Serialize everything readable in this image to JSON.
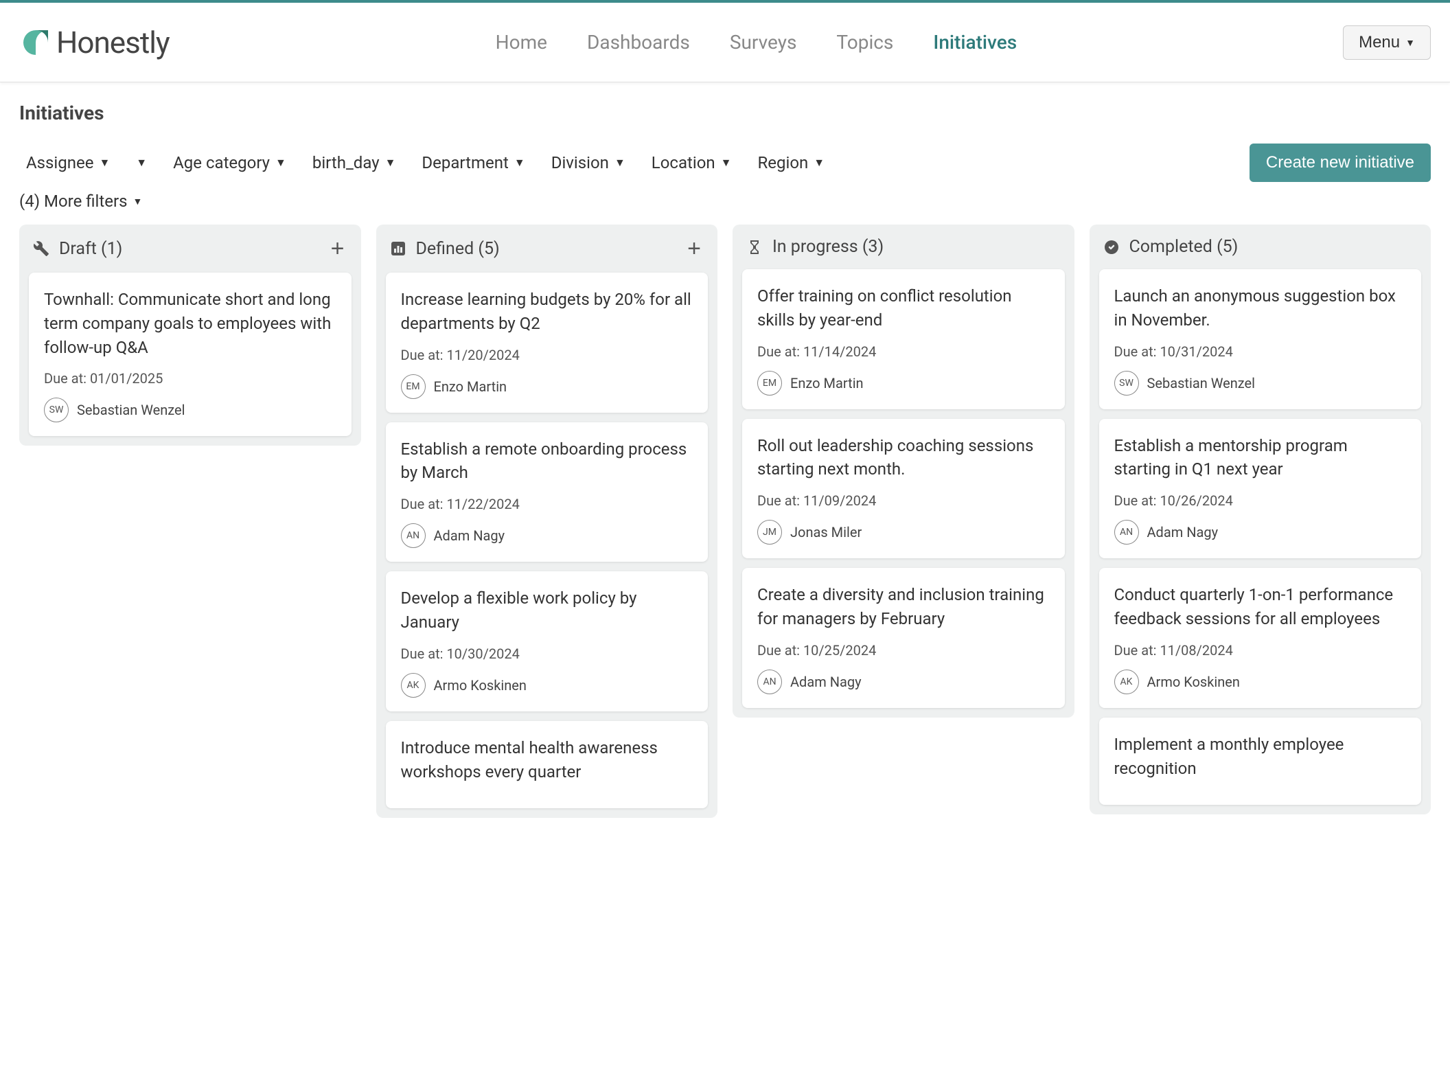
{
  "brand": "Honestly",
  "nav": {
    "items": [
      {
        "label": "Home",
        "active": false
      },
      {
        "label": "Dashboards",
        "active": false
      },
      {
        "label": "Surveys",
        "active": false
      },
      {
        "label": "Topics",
        "active": false
      },
      {
        "label": "Initiatives",
        "active": true
      }
    ],
    "menu_label": "Menu"
  },
  "page": {
    "title": "Initiatives"
  },
  "filters": {
    "items": [
      {
        "label": "Assignee"
      },
      {
        "label": ""
      },
      {
        "label": "Age category"
      },
      {
        "label": "birth_day"
      },
      {
        "label": "Department"
      },
      {
        "label": "Division"
      },
      {
        "label": "Location"
      },
      {
        "label": "Region"
      }
    ],
    "more_label": "(4) More filters",
    "create_label": "Create new initiative"
  },
  "columns": [
    {
      "icon": "tools",
      "title": "Draft (1)",
      "addable": true,
      "cards": [
        {
          "title": "Townhall: Communicate short and long term company goals to employees with follow-up Q&A",
          "due": "Due at: 01/01/2025",
          "assignee_initials": "SW",
          "assignee_name": "Sebastian Wenzel"
        }
      ]
    },
    {
      "icon": "barchart",
      "title": "Defined (5)",
      "addable": true,
      "cards": [
        {
          "title": "Increase learning budgets by 20% for all departments by Q2",
          "due": "Due at: 11/20/2024",
          "assignee_initials": "EM",
          "assignee_name": "Enzo Martin"
        },
        {
          "title": "Establish a remote onboarding process by March",
          "due": "Due at: 11/22/2024",
          "assignee_initials": "AN",
          "assignee_name": "Adam Nagy"
        },
        {
          "title": "Develop a flexible work policy by January",
          "due": "Due at: 10/30/2024",
          "assignee_initials": "AK",
          "assignee_name": "Armo Koskinen"
        },
        {
          "title": "Introduce mental health awareness workshops every quarter",
          "due": "",
          "assignee_initials": "",
          "assignee_name": ""
        }
      ]
    },
    {
      "icon": "hourglass",
      "title": "In progress (3)",
      "addable": false,
      "cards": [
        {
          "title": "Offer training on conflict resolution skills by year-end",
          "due": "Due at: 11/14/2024",
          "assignee_initials": "EM",
          "assignee_name": "Enzo Martin"
        },
        {
          "title": "Roll out leadership coaching sessions starting next month.",
          "due": "Due at: 11/09/2024",
          "assignee_initials": "JM",
          "assignee_name": "Jonas Miler"
        },
        {
          "title": "Create a diversity and inclusion training for managers by February",
          "due": "Due at: 10/25/2024",
          "assignee_initials": "AN",
          "assignee_name": "Adam Nagy"
        }
      ]
    },
    {
      "icon": "checkcircle",
      "title": "Completed (5)",
      "addable": false,
      "cards": [
        {
          "title": "Launch an anonymous suggestion box in November.",
          "due": "Due at: 10/31/2024",
          "assignee_initials": "SW",
          "assignee_name": "Sebastian Wenzel"
        },
        {
          "title": "Establish a mentorship program starting in Q1 next year",
          "due": "Due at: 10/26/2024",
          "assignee_initials": "AN",
          "assignee_name": "Adam Nagy"
        },
        {
          "title": "Conduct quarterly 1-on-1 performance feedback sessions for all employees",
          "due": "Due at: 11/08/2024",
          "assignee_initials": "AK",
          "assignee_name": "Armo Koskinen"
        },
        {
          "title": "Implement a monthly employee recognition",
          "due": "",
          "assignee_initials": "",
          "assignee_name": ""
        }
      ]
    }
  ]
}
